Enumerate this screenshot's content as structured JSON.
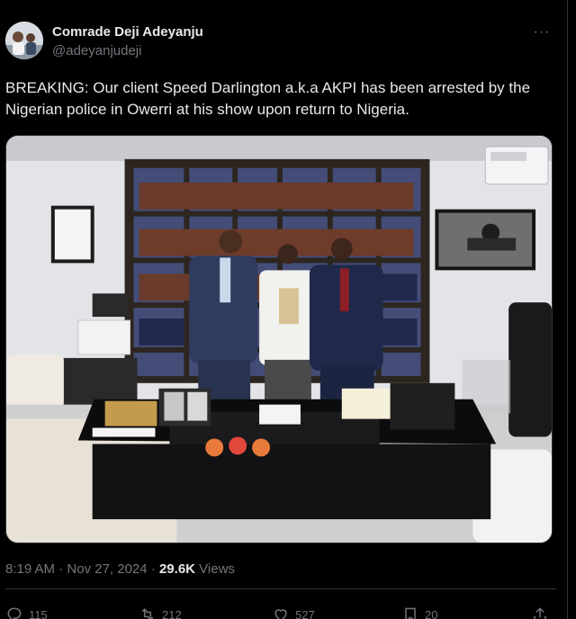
{
  "author": {
    "display_name": "Comrade Deji Adeyanju",
    "handle": "@adeyanjudeji"
  },
  "more_label": "···",
  "tweet": {
    "text": "BREAKING: Our client Speed Darlington a.k.a AKPI has been arrested by the Nigerian police in Owerri at his show upon return to Nigeria."
  },
  "meta": {
    "time": "8:19 AM",
    "separator": " · ",
    "date": "Nov 27, 2024",
    "separator2": " · ",
    "views_count": "29.6K",
    "views_label": " Views"
  },
  "actions": {
    "replies": "115",
    "reposts": "212",
    "likes": "527",
    "bookmarks": "20"
  },
  "icons": {
    "reply": "reply-icon",
    "repost": "repost-icon",
    "like": "heart-icon",
    "bookmark": "bookmark-icon",
    "share": "share-icon",
    "more": "more-icon"
  },
  "colors": {
    "background": "#000000",
    "text": "#e7e9ea",
    "secondary": "#71767b",
    "border": "#2f3336"
  }
}
